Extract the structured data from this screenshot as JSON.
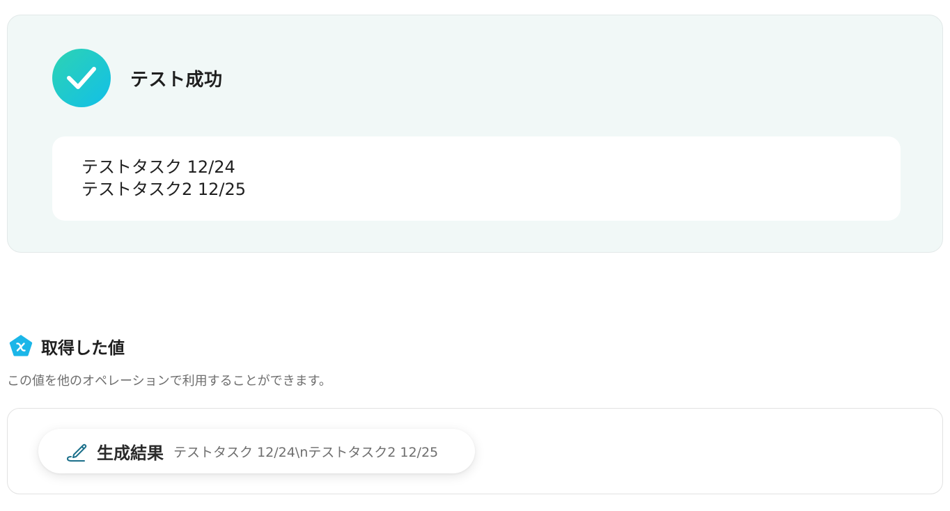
{
  "success": {
    "title": "テスト成功",
    "result_lines": [
      "テストタスク 12/24",
      "テストタスク2 12/25"
    ]
  },
  "acquired": {
    "title": "取得した値",
    "description": "この値を他のオペレーションで利用することができます。",
    "items": [
      {
        "label": "生成結果",
        "value": "テストタスク 12/24\\nテストタスク2 12/25"
      }
    ]
  },
  "icons": {
    "success": "check-icon",
    "section": "variable-pentagon-icon",
    "item": "pen-icon"
  },
  "colors": {
    "success_bg": "#f1f8f7",
    "accent_gradient_start": "#2dd3b3",
    "accent_gradient_end": "#12bfe8",
    "section_icon": "#1bb6e8",
    "pen_icon": "#1b6f8a"
  }
}
